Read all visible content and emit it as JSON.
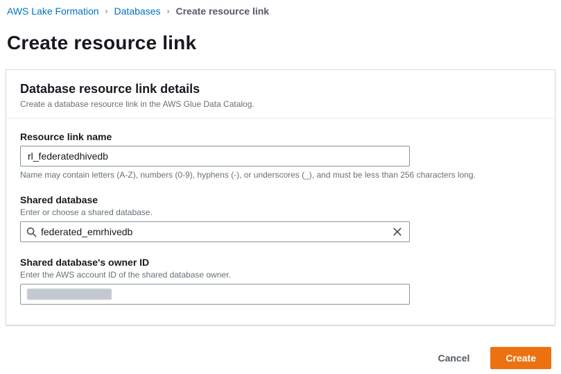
{
  "breadcrumb": {
    "separator": "›",
    "items": [
      {
        "label": "AWS Lake Formation"
      },
      {
        "label": "Databases"
      },
      {
        "label": "Create resource link"
      }
    ]
  },
  "page": {
    "title": "Create resource link"
  },
  "panel": {
    "title": "Database resource link details",
    "description": "Create a database resource link in the AWS Glue Data Catalog.",
    "fields": {
      "resource_link_name": {
        "label": "Resource link name",
        "value": "rl_federatedhivedb",
        "constraint": "Name may contain letters (A-Z), numbers (0-9), hyphens (-), or underscores (_), and must be less than 256 characters long."
      },
      "shared_database": {
        "label": "Shared database",
        "description": "Enter or choose a shared database.",
        "value": "federated_emrhivedb"
      },
      "shared_database_owner": {
        "label": "Shared database's owner ID",
        "description": "Enter the AWS account ID of the shared database owner.",
        "value": ""
      }
    }
  },
  "actions": {
    "cancel_label": "Cancel",
    "create_label": "Create"
  },
  "icons": {
    "search": "search-icon",
    "clear": "close-icon"
  },
  "colors": {
    "link": "#0073bb",
    "primary_button": "#ec7211",
    "panel_border": "#d5dbdb",
    "muted_text": "#687078"
  }
}
